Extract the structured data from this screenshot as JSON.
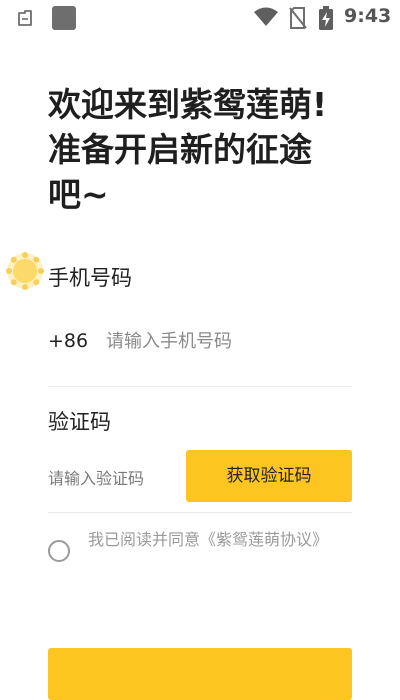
{
  "status_bar": {
    "time": "9:43",
    "icons": [
      "notification-icon",
      "app-square-icon",
      "wifi-icon",
      "no-sim-icon",
      "battery-charging-icon"
    ]
  },
  "welcome": {
    "line1": "欢迎来到紫鸳莲萌!",
    "line2": "准备开启新的征途",
    "line3": "吧~"
  },
  "phone": {
    "label": "手机号码",
    "country_code": "+86",
    "placeholder": "请输入手机号码"
  },
  "verification": {
    "label": "验证码",
    "placeholder": "请输入验证码",
    "get_code_button": "获取验证码"
  },
  "agreement": {
    "text": "我已阅读并同意《紫鸳莲萌协议》"
  },
  "colors": {
    "accent": "#fdc520",
    "text": "#1f1f1f",
    "muted": "#9a9a9a"
  }
}
